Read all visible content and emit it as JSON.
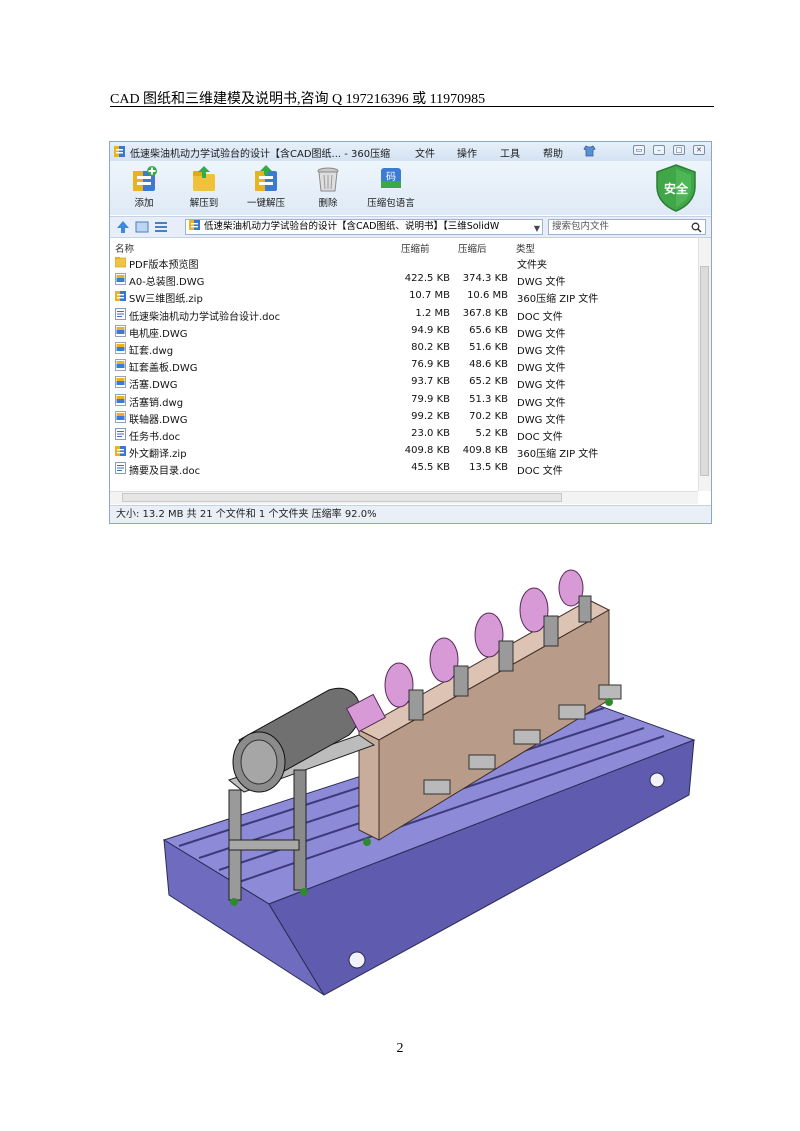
{
  "doc_header": "CAD 图纸和三维建模及说明书,咨询 Q 197216396  或  11970985",
  "window": {
    "title": "低速柴油机动力学试验台的设计【含CAD图纸...  - 360压缩",
    "menu": [
      "文件",
      "操作",
      "工具",
      "帮助"
    ]
  },
  "toolbar": {
    "buttons": [
      {
        "label": "添加",
        "icon": "add-archive-icon"
      },
      {
        "label": "解压到",
        "icon": "extract-to-icon"
      },
      {
        "label": "一键解压",
        "icon": "one-click-extract-icon"
      },
      {
        "label": "删除",
        "icon": "delete-trash-icon"
      },
      {
        "label": "压缩包语言",
        "icon": "archive-language-icon"
      }
    ],
    "code_icon_text": "码",
    "safe_badge": "安全"
  },
  "address": {
    "path": "低速柴油机动力学试验台的设计【含CAD图纸、说明书】【三维SolidW",
    "search_placeholder": "搜索包内文件"
  },
  "columns": {
    "name": "名称",
    "before": "压缩前",
    "after": "压缩后",
    "type": "类型"
  },
  "files": [
    {
      "name": "PDF版本预览图",
      "before": "",
      "after": "",
      "type": "文件夹",
      "kind": "folder"
    },
    {
      "name": "A0-总装图.DWG",
      "before": "422.5 KB",
      "after": "374.3 KB",
      "type": "DWG 文件",
      "kind": "dwg"
    },
    {
      "name": "SW三维图纸.zip",
      "before": "10.7 MB",
      "after": "10.6 MB",
      "type": "360压缩 ZIP 文件",
      "kind": "zip"
    },
    {
      "name": "低速柴油机动力学试验台设计.doc",
      "before": "1.2 MB",
      "after": "367.8 KB",
      "type": "DOC 文件",
      "kind": "doc"
    },
    {
      "name": "电机座.DWG",
      "before": "94.9 KB",
      "after": "65.6 KB",
      "type": "DWG 文件",
      "kind": "dwg"
    },
    {
      "name": "缸套.dwg",
      "before": "80.2 KB",
      "after": "51.6 KB",
      "type": "DWG 文件",
      "kind": "dwg"
    },
    {
      "name": "缸套盖板.DWG",
      "before": "76.9 KB",
      "after": "48.6 KB",
      "type": "DWG 文件",
      "kind": "dwg"
    },
    {
      "name": "活塞.DWG",
      "before": "93.7 KB",
      "after": "65.2 KB",
      "type": "DWG 文件",
      "kind": "dwg"
    },
    {
      "name": "活塞销.dwg",
      "before": "79.9 KB",
      "after": "51.3 KB",
      "type": "DWG 文件",
      "kind": "dwg"
    },
    {
      "name": "联轴器.DWG",
      "before": "99.2 KB",
      "after": "70.2 KB",
      "type": "DWG 文件",
      "kind": "dwg"
    },
    {
      "name": "任务书.doc",
      "before": "23.0 KB",
      "after": "5.2 KB",
      "type": "DOC 文件",
      "kind": "doc"
    },
    {
      "name": "外文翻译.zip",
      "before": "409.8 KB",
      "after": "409.8 KB",
      "type": "360压缩 ZIP 文件",
      "kind": "zip"
    },
    {
      "name": "摘要及目录.doc",
      "before": "45.5 KB",
      "after": "13.5 KB",
      "type": "DOC 文件",
      "kind": "doc"
    }
  ],
  "status": "大小: 13.2 MB 共 21 个文件和 1 个文件夹 压缩率 92.0%",
  "page_number": "2",
  "colors": {
    "accent": "#2e7d32",
    "window_border": "#8ea6c2",
    "model_base": "#7b79c9",
    "model_frame": "#c9ad9c",
    "model_cylinders": "#d79ad6"
  }
}
